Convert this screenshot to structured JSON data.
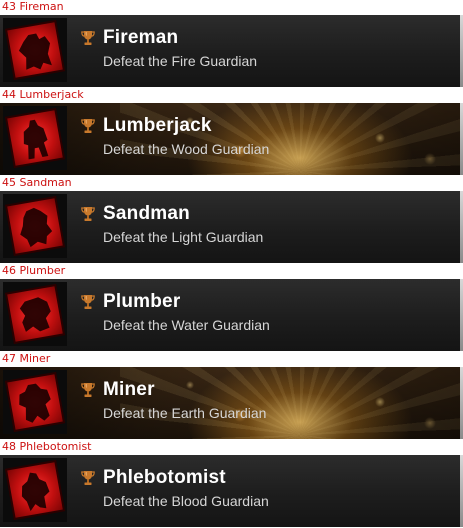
{
  "trophies": [
    {
      "caption": "43 Fireman",
      "title": "Fireman",
      "description": "Defeat the Fire Guardian",
      "style": "dark",
      "icon": "fire-guardian-silhouette-icon"
    },
    {
      "caption": "44 Lumberjack",
      "title": "Lumberjack",
      "description": "Defeat the Wood Guardian",
      "style": "gold",
      "icon": "wood-guardian-silhouette-icon"
    },
    {
      "caption": "45 Sandman",
      "title": "Sandman",
      "description": "Defeat the Light Guardian",
      "style": "dark",
      "icon": "light-guardian-silhouette-icon"
    },
    {
      "caption": "46 Plumber",
      "title": "Plumber",
      "description": "Defeat the Water Guardian",
      "style": "dark",
      "icon": "water-guardian-silhouette-icon"
    },
    {
      "caption": "47 Miner",
      "title": "Miner",
      "description": "Defeat the Earth Guardian",
      "style": "gold",
      "icon": "earth-guardian-silhouette-icon"
    },
    {
      "caption": "48 Phlebotomist",
      "title": "Phlebotomist",
      "description": "Defeat the Blood Guardian",
      "style": "dark",
      "icon": "blood-guardian-silhouette-icon"
    }
  ],
  "colors": {
    "caption": "#cc1111",
    "trophy_bronze": "#c8792c",
    "icon_red": "#c10f0f"
  }
}
